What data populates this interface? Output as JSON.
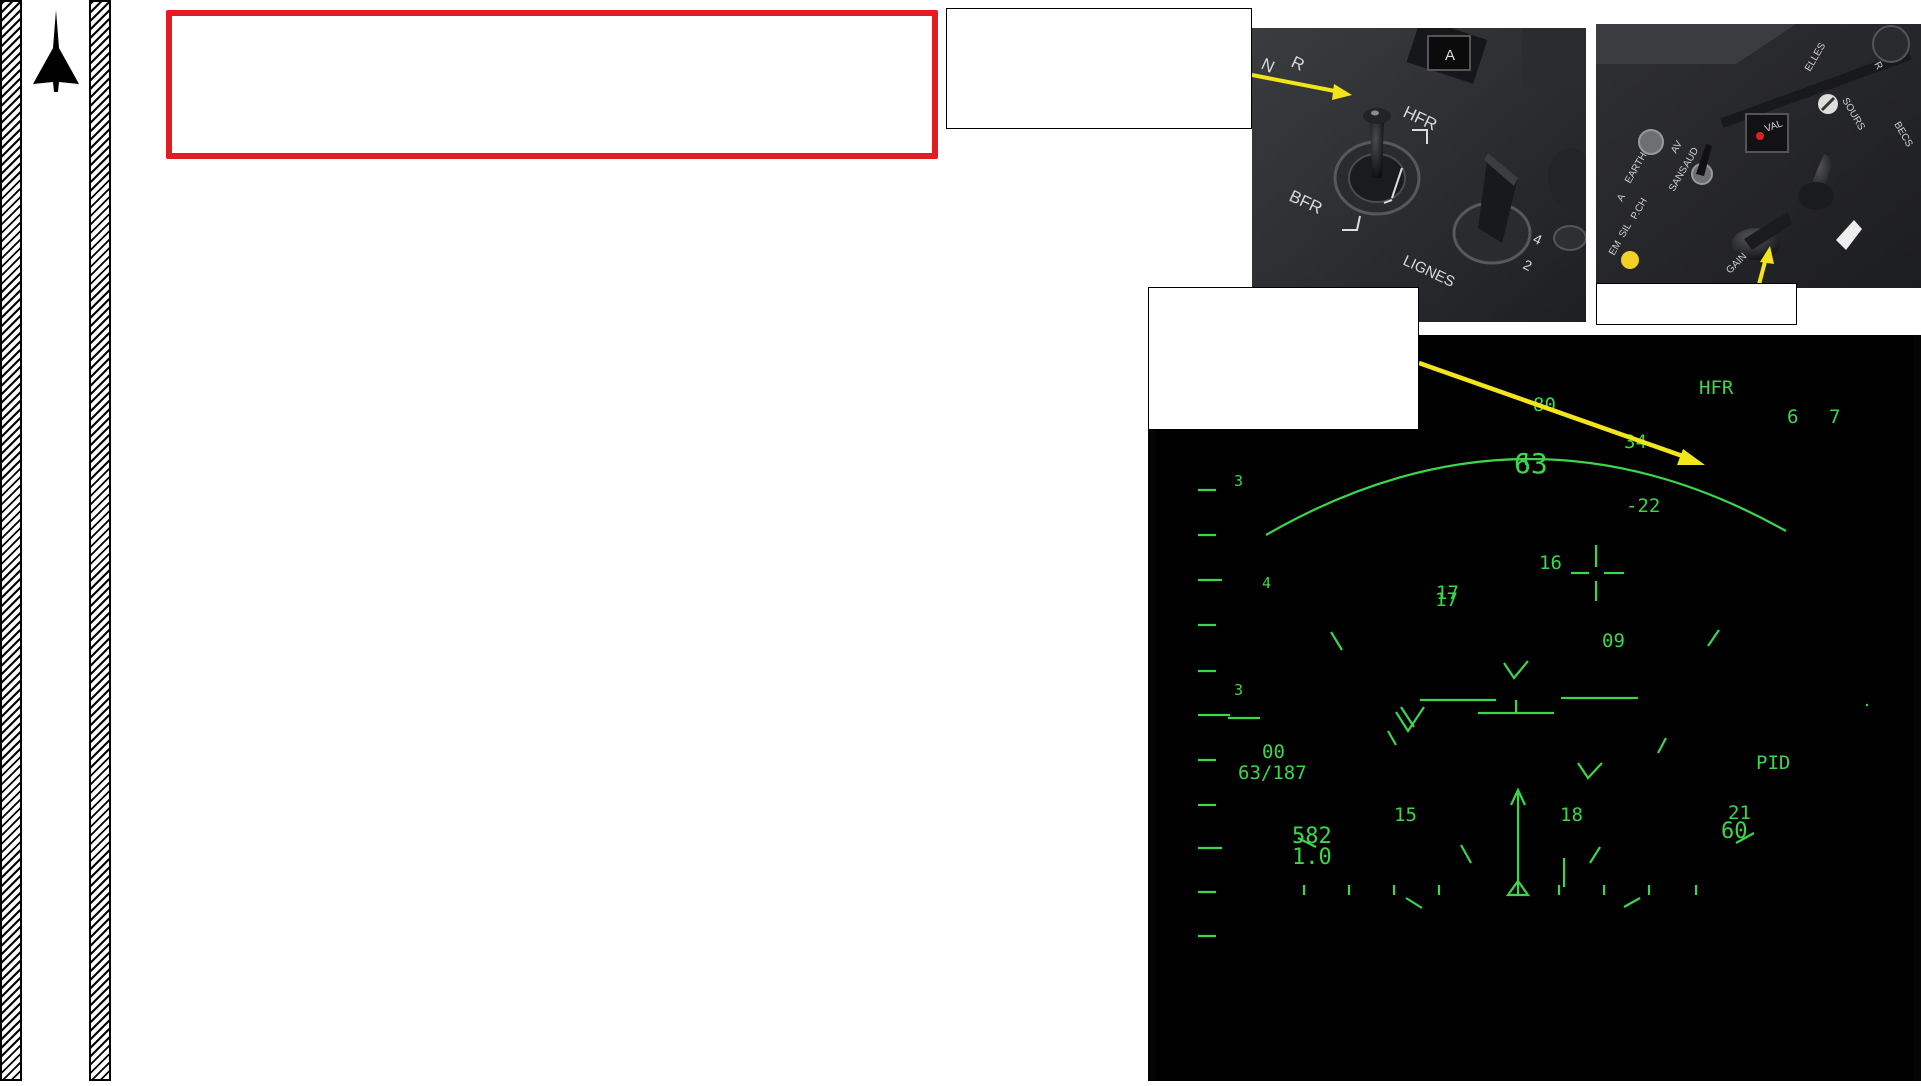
{
  "photos": {
    "switch_panel": {
      "labels": [
        "R",
        "A",
        "HFR",
        "BFR",
        "LIGNES",
        "4",
        "2"
      ]
    },
    "audio_panel": {
      "labels": [
        "SOURS",
        "R",
        "BECS",
        "VAL",
        "AV",
        "AUD",
        "SANS",
        "EARTH",
        "A",
        "P.CH",
        "SIL",
        "EM",
        "GAIN",
        "ELLES"
      ]
    }
  },
  "hud": {
    "bfr_hfr_indicator": "HFR",
    "heading_top": "80",
    "scale_right_a": "6",
    "scale_right_b": "7",
    "target_alt": "34",
    "closure": "63",
    "target_vs": "-22",
    "ladder_mark_top": "3",
    "ladder_mark_mid": "4",
    "ladder_mark_bottom": "3",
    "contact_1": "16",
    "contact_2": "17",
    "contact_2b": "17",
    "contact_3": "09",
    "range_top": "00",
    "range_scale": "63/187",
    "mode": "PID",
    "heading_ticks": [
      "15",
      "18",
      "21"
    ],
    "ground_speed": "582",
    "gain": "1.0",
    "range_right": "60"
  },
  "colors": {
    "accent_red": "#e31b23",
    "arrow_yellow": "#f2e51a",
    "hud_green": "#3bd64a"
  }
}
